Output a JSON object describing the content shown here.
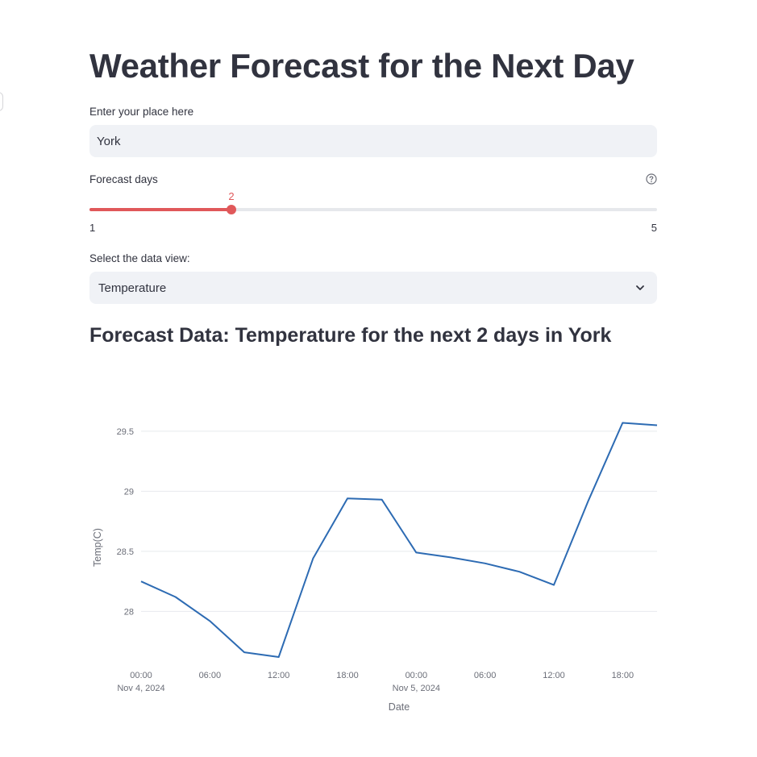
{
  "page": {
    "title": "Weather Forecast for the Next Day",
    "place_label": "Enter your place here",
    "place_value": "York",
    "days_label": "Forecast days",
    "days_value": "2",
    "days_min": "1",
    "days_max": "5",
    "view_label": "Select the data view:",
    "view_value": "Temperature",
    "subtitle": "Forecast Data: Temperature for the next 2 days in York"
  },
  "slider": {
    "min": 1,
    "max": 5,
    "value": 2
  },
  "colors": {
    "accent": "#e0585a",
    "line": "#2d6bb3",
    "grid": "#e8eaee"
  },
  "icons": {
    "help": "question-circle-icon",
    "select": "chevron-down-icon"
  },
  "chart_data": {
    "type": "line",
    "xlabel": "Date",
    "ylabel": "Temp(C)",
    "ylim": [
      27.6,
      29.6
    ],
    "yticks": [
      28,
      28.5,
      29,
      29.5
    ],
    "ytick_labels": [
      "28",
      "28.5",
      "29",
      "29.5"
    ],
    "xlim": [
      0,
      45
    ],
    "xticks": [
      {
        "hour": 0,
        "label": "00:00",
        "sub": "Nov 4, 2024"
      },
      {
        "hour": 6,
        "label": "06:00",
        "sub": ""
      },
      {
        "hour": 12,
        "label": "12:00",
        "sub": ""
      },
      {
        "hour": 18,
        "label": "18:00",
        "sub": ""
      },
      {
        "hour": 24,
        "label": "00:00",
        "sub": "Nov 5, 2024"
      },
      {
        "hour": 30,
        "label": "06:00",
        "sub": ""
      },
      {
        "hour": 36,
        "label": "12:00",
        "sub": ""
      },
      {
        "hour": 42,
        "label": "18:00",
        "sub": ""
      }
    ],
    "series": [
      {
        "x": [
          0,
          3,
          6,
          9,
          12,
          15,
          18,
          21,
          24,
          27,
          30,
          33,
          36,
          39,
          42,
          45
        ],
        "y": [
          28.25,
          28.12,
          27.92,
          27.66,
          27.62,
          28.44,
          28.94,
          28.93,
          28.49,
          28.45,
          28.4,
          28.33,
          28.22,
          28.92,
          29.57,
          29.55
        ]
      }
    ]
  }
}
